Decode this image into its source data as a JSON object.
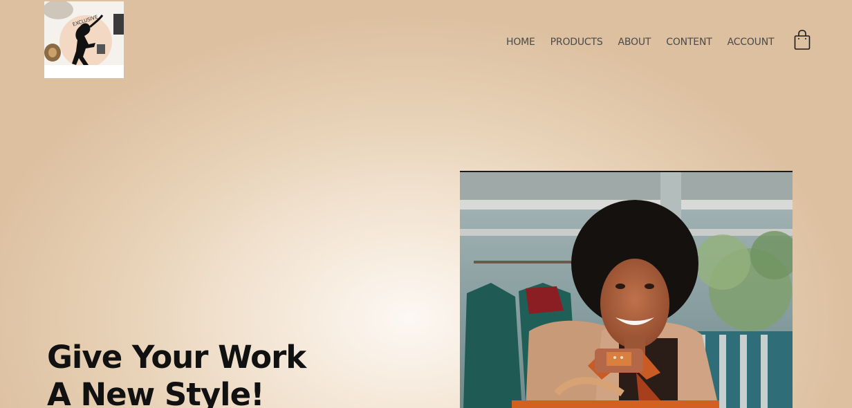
{
  "header": {
    "logo_icon": "exclusive-logo-icon",
    "logo_text": "EXCLUSIVE",
    "cart_icon": "shopping-bag-icon"
  },
  "nav": {
    "items": [
      {
        "label": "HOME"
      },
      {
        "label": "PRODUCTS"
      },
      {
        "label": "ABOUT"
      },
      {
        "label": "CONTENT"
      },
      {
        "label": "ACCOUNT"
      }
    ]
  },
  "hero": {
    "title_line_1": "Give Your Work",
    "title_line_2": "A New Style!",
    "image_icon": "woman-holding-bag-photo"
  },
  "colors": {
    "background": "#e6cfb3",
    "text": "#111111",
    "nav_text": "#4a4a4a"
  }
}
